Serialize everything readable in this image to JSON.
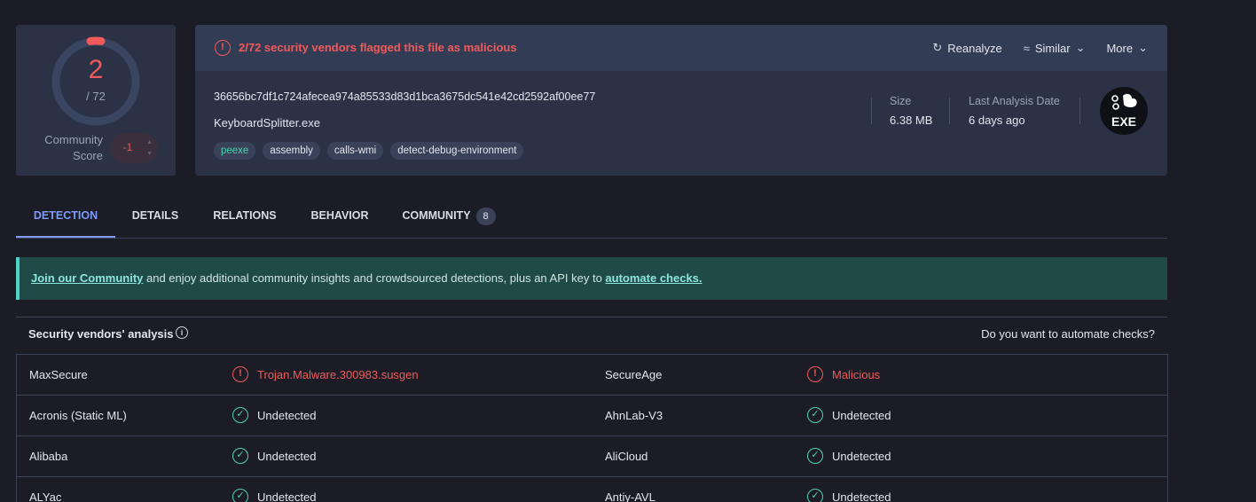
{
  "score": {
    "detections": "2",
    "total": "/ 72",
    "community_label_line1": "Community",
    "community_label_line2": "Score",
    "community_score": "-1"
  },
  "header": {
    "alert": "2/72 security vendors flagged this file as malicious",
    "actions": {
      "reanalyze": "Reanalyze",
      "similar": "Similar",
      "more": "More"
    },
    "hash": "36656bc7df1c724afecea974a85533d83d1bca3675dc541e42cd2592af00ee77",
    "filename": "KeyboardSplitter.exe",
    "tags": [
      "peexe",
      "assembly",
      "calls-wmi",
      "detect-debug-environment"
    ],
    "size_label": "Size",
    "size_value": "6.38 MB",
    "date_label": "Last Analysis Date",
    "date_value": "6 days ago",
    "file_type": "EXE"
  },
  "tabs": [
    {
      "label": "DETECTION",
      "active": true
    },
    {
      "label": "DETAILS"
    },
    {
      "label": "RELATIONS"
    },
    {
      "label": "BEHAVIOR"
    },
    {
      "label": "COMMUNITY",
      "badge": "8"
    }
  ],
  "banner": {
    "link1": "Join our Community",
    "middle": " and enjoy additional community insights and crowdsourced detections, plus an API key to ",
    "link2": "automate checks."
  },
  "vendors": {
    "title": "Security vendors' analysis",
    "automate_prompt": "Do you want to automate checks?",
    "rows": [
      {
        "left": {
          "name": "MaxSecure",
          "result": "Trojan.Malware.300983.susgen",
          "status": "bad"
        },
        "right": {
          "name": "SecureAge",
          "result": "Malicious",
          "status": "bad"
        }
      },
      {
        "left": {
          "name": "Acronis (Static ML)",
          "result": "Undetected",
          "status": "ok"
        },
        "right": {
          "name": "AhnLab-V3",
          "result": "Undetected",
          "status": "ok"
        }
      },
      {
        "left": {
          "name": "Alibaba",
          "result": "Undetected",
          "status": "ok"
        },
        "right": {
          "name": "AliCloud",
          "result": "Undetected",
          "status": "ok"
        }
      },
      {
        "left": {
          "name": "ALYac",
          "result": "Undetected",
          "status": "ok"
        },
        "right": {
          "name": "Antiy-AVL",
          "result": "Undetected",
          "status": "ok"
        }
      }
    ]
  },
  "colors": {
    "background": "#1b1c26",
    "card": "#2b3246",
    "danger": "#f05a5a",
    "ok": "#4fd1b2",
    "accent": "#7c9cf8"
  },
  "icons": {
    "alert": "alert-circle-icon",
    "reanalyze": "refresh-icon",
    "similar": "similar-icon",
    "chevron": "chevron-down-icon",
    "info": "info-icon",
    "ok": "check-circle-icon"
  }
}
